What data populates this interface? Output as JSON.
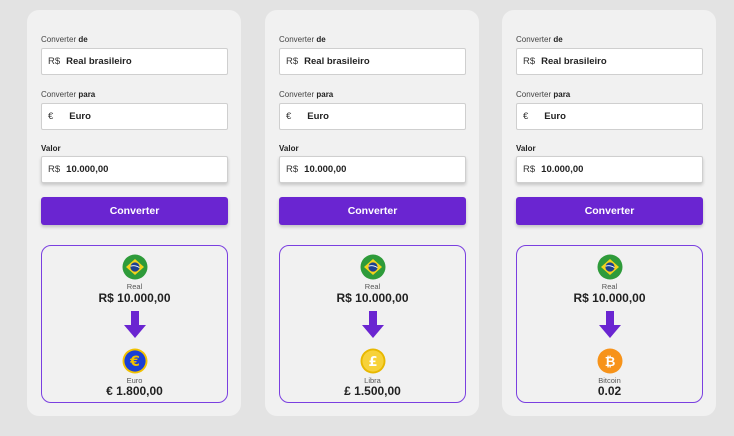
{
  "panels": [
    {
      "from_label_prefix": "Converter ",
      "from_label_bold": "de",
      "from_prefix": "R$",
      "from_value": "Real brasileiro",
      "to_label_prefix": "Converter ",
      "to_label_bold": "para",
      "to_prefix": "€",
      "to_value": "Euro",
      "amount_label": "Valor",
      "amount_prefix": "R$",
      "amount_value": "10.000,00",
      "button_label": "Converter",
      "source_name": "Real",
      "source_amount": "R$ 10.000,00",
      "target_name": "Euro",
      "target_amount": "€ 1.800,00",
      "target_icon": "euro-coin-icon"
    },
    {
      "from_label_prefix": "Converter ",
      "from_label_bold": "de",
      "from_prefix": "R$",
      "from_value": "Real brasileiro",
      "to_label_prefix": "Converter ",
      "to_label_bold": "para",
      "to_prefix": "€",
      "to_value": "Euro",
      "amount_label": "Valor",
      "amount_prefix": "R$",
      "amount_value": "10.000,00",
      "button_label": "Converter",
      "source_name": "Real",
      "source_amount": "R$ 10.000,00",
      "target_name": "Libra",
      "target_amount": "£ 1.500,00",
      "target_icon": "pound-coin-icon"
    },
    {
      "from_label_prefix": "Converter ",
      "from_label_bold": "de",
      "from_prefix": "R$",
      "from_value": "Real brasileiro",
      "to_label_prefix": "Converter ",
      "to_label_bold": "para",
      "to_prefix": "€",
      "to_value": "Euro",
      "amount_label": "Valor",
      "amount_prefix": "R$",
      "amount_value": "10.000,00",
      "button_label": "Converter",
      "source_name": "Real",
      "source_amount": "R$ 10.000,00",
      "target_name": "Bitcoin",
      "target_amount": "0.02",
      "target_icon": "bitcoin-coin-icon"
    }
  ],
  "colors": {
    "primary": "#6a25d1",
    "result_border": "#7a3fe0",
    "arrow": "#6a25d1",
    "euro_coin": "#1a3fd6",
    "pound_coin": "#f2c200",
    "bitcoin_coin": "#f7931a",
    "brazil_green": "#2e9b3a",
    "brazil_yellow": "#f3d21c",
    "brazil_blue": "#1d3f8f"
  }
}
